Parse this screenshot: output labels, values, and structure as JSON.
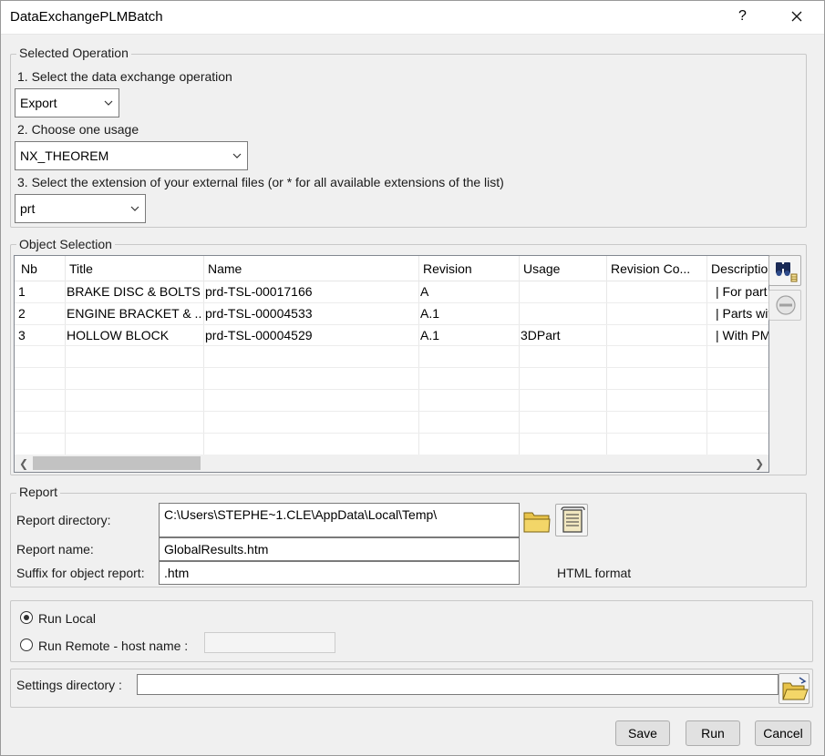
{
  "window": {
    "title": "DataExchangePLMBatch",
    "help_label": "?"
  },
  "selected_operation": {
    "group_label": "Selected Operation",
    "step1_label": "1. Select the data exchange operation",
    "operation_value": "Export",
    "step2_label": "2. Choose one usage",
    "usage_value": "NX_THEOREM",
    "step3_label": "3. Select the extension of your external files (or * for all available extensions of the list)",
    "extension_value": "prt"
  },
  "object_selection": {
    "group_label": "Object Selection",
    "columns": [
      "Nb",
      "Title",
      "Name",
      "Revision",
      "Usage",
      "Revision Co...",
      "Descriptio"
    ],
    "rows": [
      [
        "1",
        "BRAKE DISC & BOLTS",
        "prd-TSL-00017166",
        "A",
        "",
        "",
        "| For part i"
      ],
      [
        "2",
        "ENGINE BRACKET & ...",
        "prd-TSL-00004533",
        "A.1",
        "",
        "",
        "| Parts with"
      ],
      [
        "3",
        "HOLLOW BLOCK",
        "prd-TSL-00004529",
        "A.1",
        "3DPart",
        "",
        "| With PMI"
      ]
    ],
    "search_icon": "binoculars-search-icon",
    "remove_icon": "remove-icon"
  },
  "report": {
    "group_label": "Report",
    "directory_label": "Report directory:",
    "directory_value": "C:\\Users\\STEPHE~1.CLE\\AppData\\Local\\Temp\\",
    "name_label": "Report name:",
    "name_value": "GlobalResults.htm",
    "suffix_label": "Suffix for object report:",
    "suffix_value": ".htm",
    "format_label": "HTML format"
  },
  "run": {
    "local_label": "Run Local",
    "remote_label": "Run Remote - host name :",
    "host_value": "",
    "selected": "local"
  },
  "settings": {
    "label": "Settings directory :",
    "value": ""
  },
  "buttons": {
    "save": "Save",
    "run": "Run",
    "cancel": "Cancel"
  }
}
